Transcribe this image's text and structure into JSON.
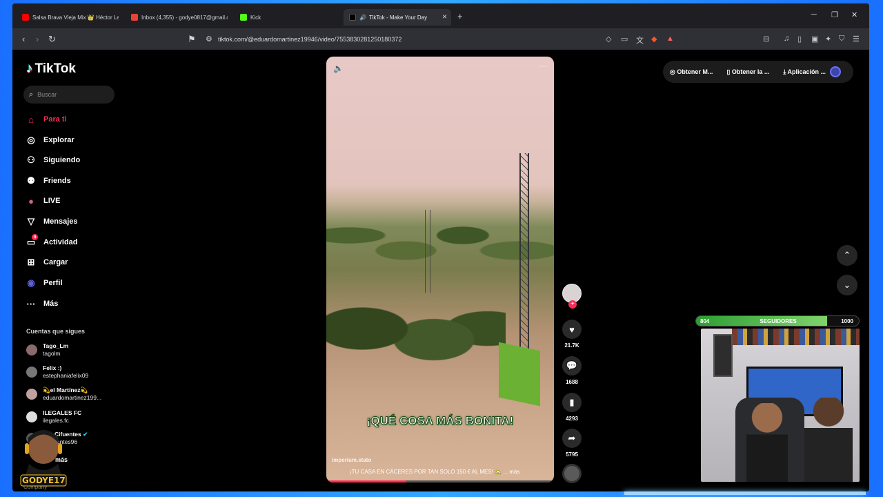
{
  "browser": {
    "tabs": [
      {
        "label": "Salsa Brava Vieja Mix 👑 Héctor Lavo",
        "icon_color": "#ff0000"
      },
      {
        "label": "Inbox (4,355) - godye0817@gmail.co",
        "icon_color": "#ea4335"
      },
      {
        "label": "Kick",
        "icon_color": "#53fc18"
      }
    ],
    "active_tab": "TikTok - Make Your Day",
    "url": "tiktok.com/@eduardomartinez19946/video/7553830281250180372"
  },
  "sidebar": {
    "logo": "TikTok",
    "search_placeholder": "Buscar",
    "nav": [
      {
        "label": "Para ti",
        "icon": "home-icon",
        "glyph": "⌂"
      },
      {
        "label": "Explorar",
        "icon": "compass-icon",
        "glyph": "◎"
      },
      {
        "label": "Siguiendo",
        "icon": "following-icon",
        "glyph": "⚇"
      },
      {
        "label": "Friends",
        "icon": "friends-icon",
        "glyph": "⚉"
      },
      {
        "label": "LIVE",
        "icon": "live-icon",
        "glyph": "●"
      },
      {
        "label": "Mensajes",
        "icon": "messages-icon",
        "glyph": "▽"
      },
      {
        "label": "Actividad",
        "icon": "activity-icon",
        "glyph": "▭",
        "badge": "4"
      },
      {
        "label": "Cargar",
        "icon": "upload-icon",
        "glyph": "⊞"
      },
      {
        "label": "Perfil",
        "icon": "profile-icon",
        "glyph": "◉"
      },
      {
        "label": "Más",
        "icon": "more-icon",
        "glyph": "···"
      }
    ],
    "following_title": "Cuentas que sigues",
    "accounts": [
      {
        "name": "Tago_Lm",
        "handle": "tagolm"
      },
      {
        "name": "Felix :)",
        "handle": "estephaniafelix09"
      },
      {
        "name": "💫el Martínez💫",
        "handle": "eduardomartinez199..."
      },
      {
        "name": "ILEGALES FC",
        "handle": "ilegales.fc"
      },
      {
        "name": "allo Cifuentes",
        "handle": "locifuentes96"
      }
    ],
    "see_more": "más",
    "company": "Company",
    "streamer_tag": "GODYE17"
  },
  "video": {
    "caption": "¡QUÉ COSA MÁS BONITA!",
    "author": "imperium.stato",
    "description": "¡TU CASA EN CÁCERES POR TAN SOLO 150 € AL MES! 🏡 ... más",
    "progress": 0.35
  },
  "actions": {
    "likes": "21.7K",
    "comments": "1688",
    "saves": "4293",
    "shares": "5795"
  },
  "topright": {
    "items": [
      "Obtener M...",
      "Obtener la ...",
      "Aplicación ..."
    ]
  },
  "overlay": {
    "followers_current": "804",
    "followers_label": "SEGUIDORES",
    "followers_goal": "1000",
    "followers_progress": 0.804
  }
}
